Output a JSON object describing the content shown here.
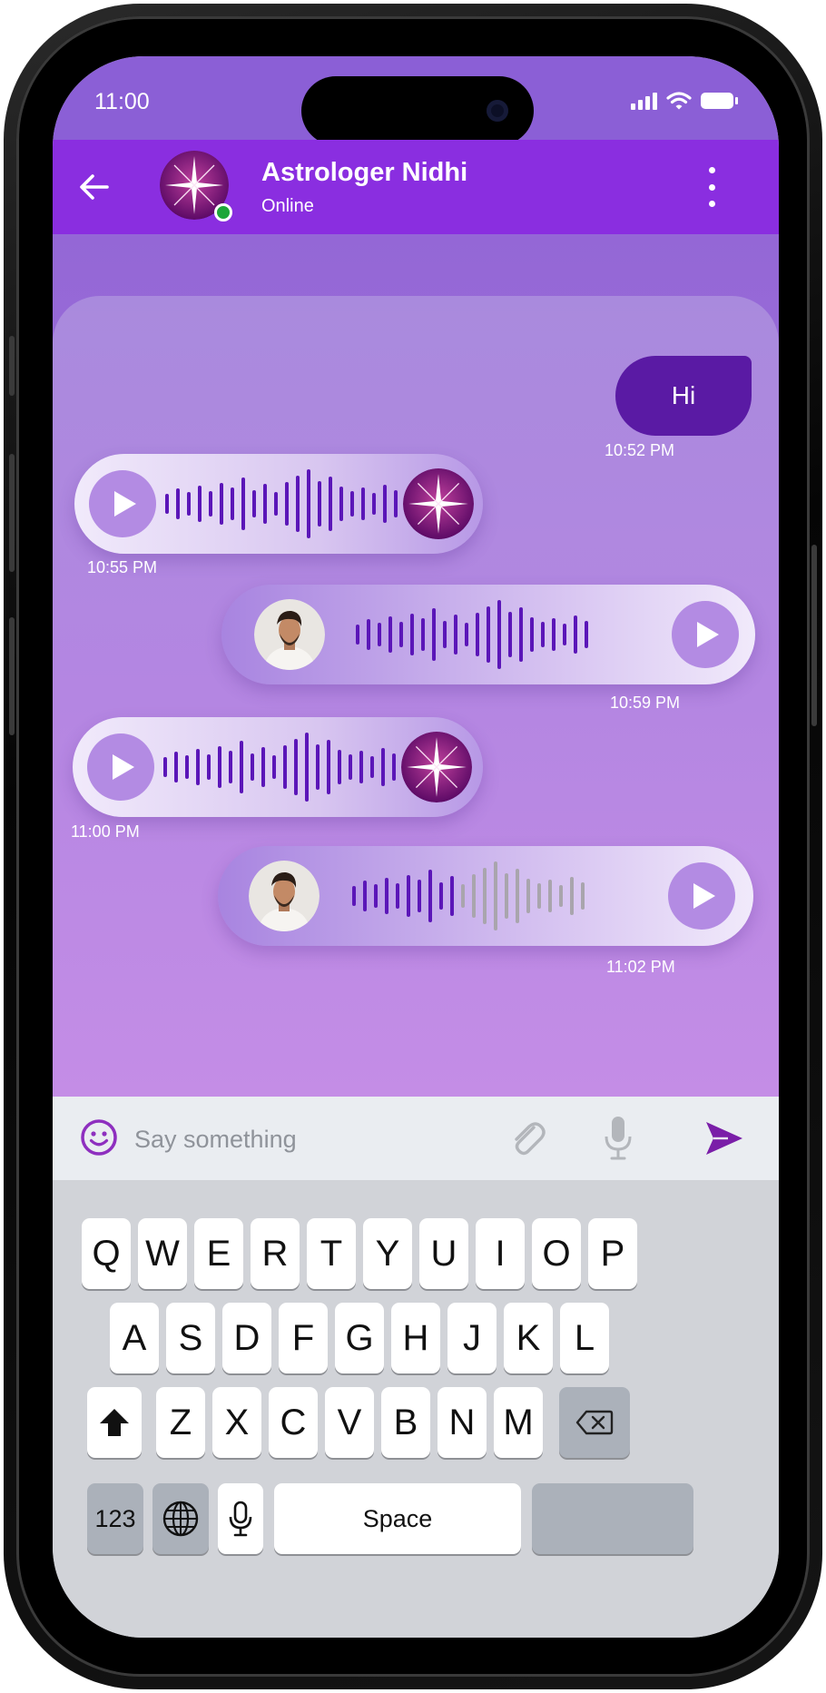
{
  "status_bar": {
    "time": "11:00"
  },
  "header": {
    "name": "Astrologer Nidhi",
    "status": "Online"
  },
  "messages": {
    "m1": {
      "text": "Hi",
      "time": "10:52 PM"
    },
    "m2": {
      "time": "10:55 PM"
    },
    "m3": {
      "time": "10:59 PM"
    },
    "m4": {
      "time": "11:00 PM"
    },
    "m5": {
      "time": "11:02 PM"
    }
  },
  "composer": {
    "placeholder": "Say something"
  },
  "keyboard": {
    "row1": [
      "Q",
      "W",
      "E",
      "R",
      "T",
      "Y",
      "U",
      "I",
      "O",
      "P"
    ],
    "row2": [
      "A",
      "S",
      "D",
      "F",
      "G",
      "H",
      "J",
      "K",
      "L"
    ],
    "row3": [
      "Z",
      "X",
      "C",
      "V",
      "B",
      "N",
      "M"
    ],
    "numbers_label": "123",
    "space_label": "Space"
  },
  "colors": {
    "header": "#8a2ee0",
    "accent": "#5a1aa4",
    "online": "#1ea63a",
    "waveform": "#5b16b8",
    "waveform_unplayed": "#a9a5ad"
  }
}
